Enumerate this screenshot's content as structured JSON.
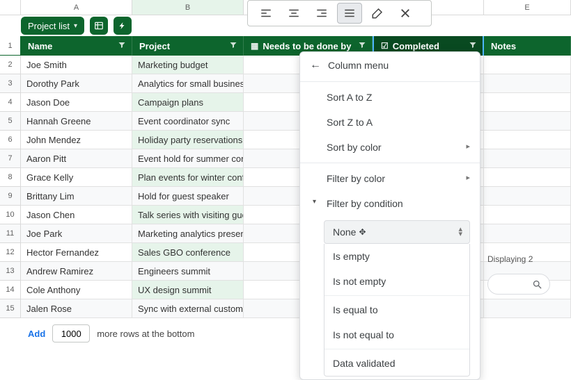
{
  "columns": {
    "A": "A",
    "B": "B",
    "E": "E"
  },
  "chip": {
    "label": "Project list"
  },
  "headers": {
    "name": "Name",
    "project": "Project",
    "due": "Needs to be done by",
    "completed": "Completed",
    "notes": "Notes"
  },
  "rows": [
    {
      "n": "2",
      "name": "Joe Smith",
      "project": "Marketing budget"
    },
    {
      "n": "3",
      "name": "Dorothy Park",
      "project": "Analytics for small businesses"
    },
    {
      "n": "4",
      "name": "Jason Doe",
      "project": "Campaign plans"
    },
    {
      "n": "5",
      "name": "Hannah Greene",
      "project": "Event coordinator sync"
    },
    {
      "n": "6",
      "name": "John Mendez",
      "project": "Holiday party reservations"
    },
    {
      "n": "7",
      "name": "Aaron Pitt",
      "project": "Event hold for summer conference"
    },
    {
      "n": "8",
      "name": "Grace Kelly",
      "project": "Plan events for winter conference"
    },
    {
      "n": "9",
      "name": "Brittany Lim",
      "project": "Hold for guest speaker"
    },
    {
      "n": "10",
      "name": "Jason Chen",
      "project": "Talk series with visiting guests"
    },
    {
      "n": "11",
      "name": "Joe Park",
      "project": "Marketing analytics presentation"
    },
    {
      "n": "12",
      "name": "Hector Fernandez",
      "project": "Sales GBO conference"
    },
    {
      "n": "13",
      "name": "Andrew Ramirez",
      "project": "Engineers summit"
    },
    {
      "n": "14",
      "name": "Cole Anthony",
      "project": "UX design summit"
    },
    {
      "n": "15",
      "name": "Jalen Rose",
      "project": "Sync with external customers"
    }
  ],
  "footer": {
    "add": "Add",
    "count": "1000",
    "suffix": "more rows at the bottom"
  },
  "menu": {
    "title": "Column menu",
    "sort_az": "Sort A to Z",
    "sort_za": "Sort Z to A",
    "sort_color": "Sort by color",
    "filter_color": "Filter by color",
    "filter_condition": "Filter by condition",
    "condition_selected": "None",
    "options": {
      "is_empty": "Is empty",
      "is_not_empty": "Is not empty",
      "is_equal": "Is equal to",
      "is_not_equal": "Is not equal to",
      "data_validated": "Data validated"
    }
  },
  "side": {
    "displaying": "Displaying 2"
  },
  "header_row_num": "1"
}
